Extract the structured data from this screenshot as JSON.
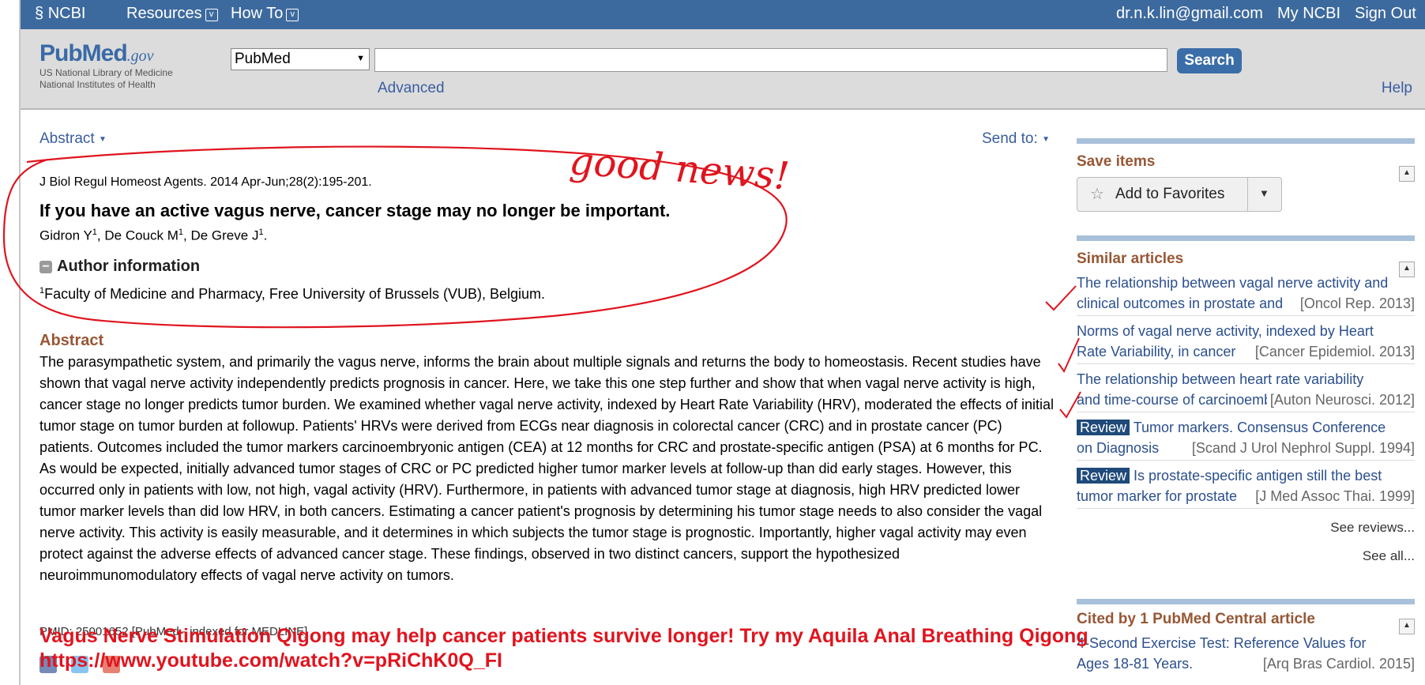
{
  "topbar": {
    "ncbi": "NCBI",
    "resources": "Resources",
    "howto": "How To",
    "email": "dr.n.k.lin@gmail.com",
    "my_ncbi": "My NCBI",
    "sign_out": "Sign Out",
    "bg_color": "#3d6a9e"
  },
  "header": {
    "logo_pub": "PubMed",
    "logo_gov": ".gov",
    "logo_line1": "US National Library of Medicine",
    "logo_line2": "National Institutes of Health",
    "db_selected": "PubMed",
    "search_value": "",
    "search_button": "Search",
    "advanced": "Advanced",
    "help": "Help"
  },
  "main": {
    "format_menu": "Abstract",
    "send_to": "Send to:",
    "journal": "J Biol Regul Homeost Agents.",
    "citation_rest": " 2014 Apr-Jun;28(2):195-201.",
    "title": "If you have an active vagus nerve, cancer stage may no longer be important.",
    "authors": [
      {
        "name": "Gidron Y",
        "sup": "1"
      },
      {
        "name": "De Couck M",
        "sup": "1"
      },
      {
        "name": "De Greve J",
        "sup": "1"
      }
    ],
    "author_info_heading": "Author information",
    "affiliation_sup": "1",
    "affiliation": "Faculty of Medicine and Pharmacy, Free University of Brussels (VUB), Belgium.",
    "abstract_heading": "Abstract",
    "abstract_text": "The parasympathetic system, and primarily the vagus nerve, informs the brain about multiple signals and returns the body to homeostasis. Recent studies have shown that vagal nerve activity independently predicts prognosis in cancer. Here, we take this one step further and show that when vagal nerve activity is high, cancer stage no longer predicts tumor burden. We examined whether vagal nerve activity, indexed by Heart Rate Variability (HRV), moderated the effects of initial tumor stage on tumor burden at followup. Patients' HRVs were derived from ECGs near diagnosis in colorectal cancer (CRC) and in prostate cancer (PC) patients. Outcomes included the tumor markers carcinoembryonic antigen (CEA) at 12 months for CRC and prostate-specific antigen (PSA) at 6 months for PC. As would be expected, initially advanced tumor stages of CRC or PC predicted higher tumor marker levels at follow-up than did early stages. However, this occurred only in patients with low, not high, vagal activity (HRV). Furthermore, in patients with advanced tumor stage at diagnosis, high HRV predicted lower tumor marker levels than did low HRV, in both cancers. Estimating a cancer patient's prognosis by determining his tumor stage needs to also consider the vagal nerve activity. This activity is easily measurable, and it determines in which subjects the tumor stage is prognostic. Importantly, higher vagal activity may even protect against the adverse effects of advanced cancer stage. These findings, observed in two distinct cancers, support the hypothesized neuroimmunomodulatory effects of vagal nerve activity on tumors.",
    "pmid_line": "PMID: 25001652 [PubMed - indexed for MEDLINE]"
  },
  "sidebar": {
    "save_heading": "Save items",
    "add_favorites": "Add to Favorites",
    "similar_heading": "Similar articles",
    "similar": [
      {
        "badge": "",
        "line1": "The relationship between vagal nerve activity and",
        "line2": "clinical outcomes in prostate and",
        "source": "[Oncol Rep. 2013]"
      },
      {
        "badge": "",
        "line1": "Norms of vagal nerve activity, indexed by Heart",
        "line2": "Rate Variability, in cancer",
        "source": "[Cancer Epidemiol. 2013]"
      },
      {
        "badge": "",
        "line1": "The relationship between heart rate variability",
        "line2": "and time-course of carcinoembryonic",
        "source": "[Auton Neurosci. 2012]"
      },
      {
        "badge": "Review",
        "line1": "Tumor markers. Consensus Conference",
        "line2": "on Diagnosis",
        "source": "[Scand J Urol Nephrol Suppl. 1994]"
      },
      {
        "badge": "Review",
        "line1": "Is prostate-specific antigen still the best",
        "line2": "tumor marker for prostate",
        "source": "[J Med Assoc Thai. 1999]"
      }
    ],
    "see_reviews": "See reviews...",
    "see_all": "See all...",
    "cited_heading": "Cited by 1 PubMed Central article",
    "cited": [
      {
        "line1": "4-Second Exercise Test: Reference Values for",
        "line2": "Ages 18-81 Years.",
        "source": "[Arq Bras Cardiol. 2015]"
      }
    ]
  },
  "annotations": {
    "handwriting": "good news!",
    "overlay_line1": "Vagus Nerve Stimulation Qigong may help cancer patients survive longer! Try my Aquila Anal Breathing Qigong",
    "overlay_line2": "https://www.youtube.com/watch?v=pRiChK0Q_FI",
    "ink_color": "#e0141e"
  }
}
